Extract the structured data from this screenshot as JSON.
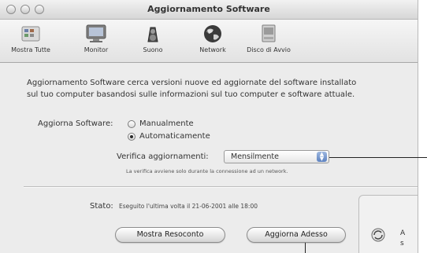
{
  "window": {
    "title": "Aggiornamento Software"
  },
  "toolbar": {
    "items": [
      {
        "label": "Mostra Tutte",
        "icon": "show-all-icon"
      },
      {
        "label": "Monitor",
        "icon": "monitor-icon"
      },
      {
        "label": "Suono",
        "icon": "sound-icon"
      },
      {
        "label": "Network",
        "icon": "network-icon"
      },
      {
        "label": "Disco di Avvio",
        "icon": "startup-disk-icon"
      }
    ]
  },
  "main": {
    "description_line1": "Aggiornamento Software cerca versioni nuove ed aggiornate del software installato",
    "description_line2": "sul tuo computer basandosi sulle informazioni sul tuo computer e software attuale.",
    "update_label": "Aggiorna Software:",
    "options": [
      {
        "label": "Manualmente",
        "checked": false
      },
      {
        "label": "Automaticamente",
        "checked": true
      }
    ],
    "check_label": "Verifica aggiornamenti:",
    "frequency_value": "Mensilmente",
    "note": "La verifica avviene solo durante la connessione ad un network.",
    "status_label": "Stato:",
    "status_value": "Eseguito l'ultima volta il 21-06-2001  alle 18:00",
    "show_log_button": "Mostra Resoconto",
    "update_now_button": "Aggiorna Adesso",
    "side_text_1": "A",
    "side_text_2": "s"
  }
}
